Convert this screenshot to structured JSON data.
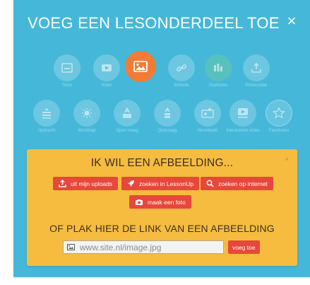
{
  "dialog": {
    "title": "VOEG EEN LESONDERDEEL TOE",
    "close_icon": "×"
  },
  "types": {
    "row1": [
      {
        "label": "Tekst",
        "icon": "text-icon"
      },
      {
        "label": "Video",
        "icon": "video-icon"
      },
      {
        "label": "",
        "icon": "image-icon",
        "active": true
      },
      {
        "label": "Website",
        "icon": "link-icon"
      },
      {
        "label": "Grafieken",
        "icon": "chart-icon"
      },
      {
        "label": "Presentatie",
        "icon": "upload-icon"
      }
    ],
    "row2": [
      {
        "label": "Opdracht",
        "icon": "question-icon"
      },
      {
        "label": "Mindmap",
        "icon": "mindmap-icon"
      },
      {
        "label": "Open vraag",
        "icon": "open-question-icon"
      },
      {
        "label": "Quizvraag",
        "icon": "quiz-icon"
      },
      {
        "label": "Woordweb",
        "icon": "hotspot-icon"
      },
      {
        "label": "Interactieve video",
        "icon": "interactive-video-icon"
      },
      {
        "label": "Favorieten",
        "icon": "star-icon"
      }
    ]
  },
  "image_card": {
    "heading": "IK WIL EEN AFBEELDING...",
    "close_icon": "×",
    "buttons": {
      "uploads": "uit mijn uploads",
      "lessonup": "zoeken in LessonUp",
      "internet": "zoeken op internet",
      "photo": "maak een foto"
    },
    "link_heading": "OF PLAK HIER DE LINK VAN EEN AFBEELDING",
    "url_placeholder": "www.site.nl/image.jpg",
    "add_button": "voeg toe"
  },
  "colors": {
    "background": "#45b8d9",
    "active_icon": "#f27b36",
    "card": "#f6bc3f",
    "button": "#e8473b"
  }
}
